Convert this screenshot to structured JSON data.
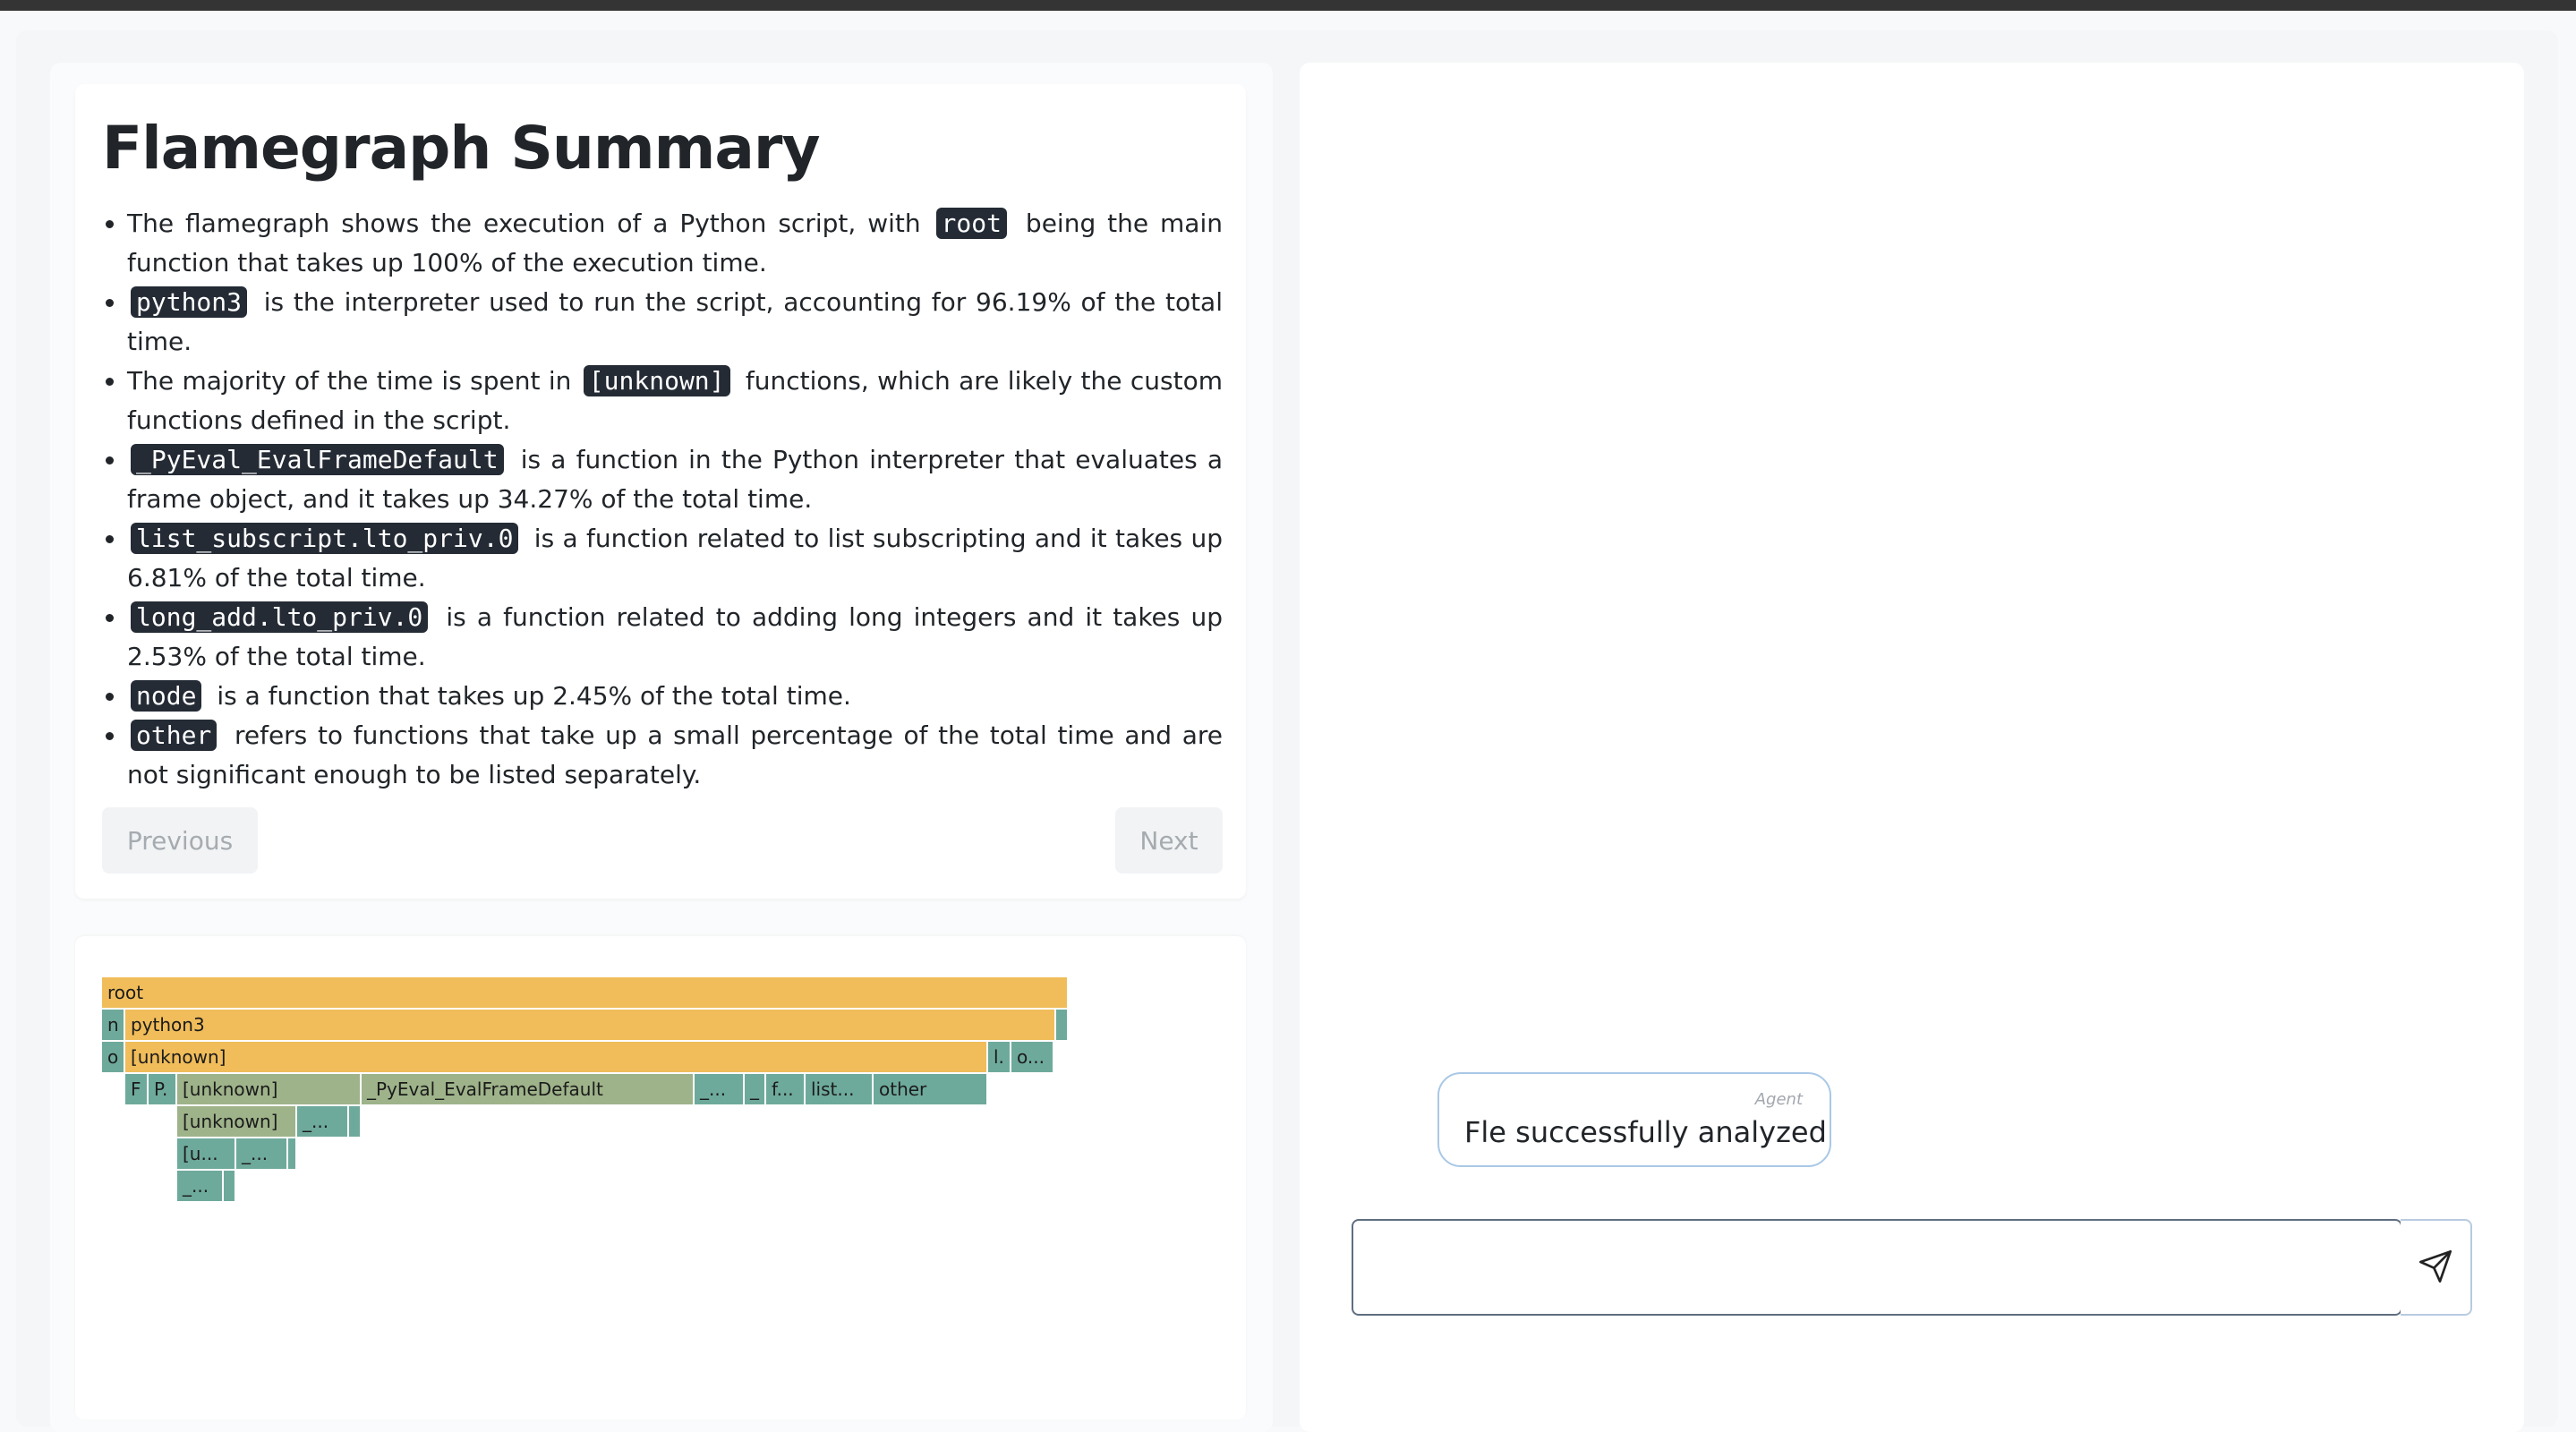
{
  "summary": {
    "title": "Flamegraph Summary",
    "bullets": [
      {
        "pre": "The flamegraph shows the execution of a Python script, with ",
        "code": "root",
        "post": " being the main function that takes up 100% of the execution time."
      },
      {
        "pre": "",
        "code": "python3",
        "post": " is the interpreter used to run the script, accounting for 96.19% of the total time."
      },
      {
        "pre": "The majority of the time is spent in ",
        "code": "[unknown]",
        "post": " functions, which are likely the custom functions defined in the script."
      },
      {
        "pre": "",
        "code": "_PyEval_EvalFrameDefault",
        "post": " is a function in the Python interpreter that evaluates a frame object, and it takes up 34.27% of the total time."
      },
      {
        "pre": "",
        "code": "list_subscript.lto_priv.0",
        "post": " is a function related to list subscripting and it takes up 6.81% of the total time."
      },
      {
        "pre": "",
        "code": "long_add.lto_priv.0",
        "post": " is a function related to adding long integers and it takes up 2.53% of the total time."
      },
      {
        "pre": "",
        "code": "node",
        "post": " is a function that takes up 2.45% of the total time."
      },
      {
        "pre": "",
        "code": "other",
        "post": " refers to functions that take up a small percentage of the total time and are not significant enough to be listed separately."
      }
    ],
    "previous_label": "Previous",
    "next_label": "Next"
  },
  "flamegraph": {
    "frames": [
      {
        "label": "root",
        "color": "gold"
      },
      {
        "label": "n",
        "color": "teal"
      },
      {
        "label": "python3",
        "color": "gold"
      },
      {
        "label": "",
        "color": "teal"
      },
      {
        "label": "o",
        "color": "teal"
      },
      {
        "label": "[unknown]",
        "color": "gold"
      },
      {
        "label": "l.",
        "color": "teal"
      },
      {
        "label": "o...",
        "color": "teal"
      },
      {
        "label": "F",
        "color": "teal"
      },
      {
        "label": "P.",
        "color": "teal"
      },
      {
        "label": "[unknown]",
        "color": "sage"
      },
      {
        "label": "_PyEval_EvalFrameDefault",
        "color": "sage"
      },
      {
        "label": "_...",
        "color": "teal"
      },
      {
        "label": "_",
        "color": "teal"
      },
      {
        "label": "f...",
        "color": "teal"
      },
      {
        "label": "list...",
        "color": "teal"
      },
      {
        "label": "other",
        "color": "teal"
      },
      {
        "label": "[unknown]",
        "color": "sage"
      },
      {
        "label": "_...",
        "color": "teal"
      },
      {
        "label": "",
        "color": "teal"
      },
      {
        "label": "[u...",
        "color": "teal"
      },
      {
        "label": "_...",
        "color": "teal"
      },
      {
        "label": "",
        "color": "teal"
      },
      {
        "label": "_...",
        "color": "teal"
      },
      {
        "label": "",
        "color": "teal"
      }
    ]
  },
  "chat": {
    "messages": [
      {
        "role": "Agent",
        "text": "Fle successfully analyzed"
      }
    ],
    "input_value": "",
    "input_placeholder": "",
    "send_icon": "paper-plane-icon"
  },
  "colors": {
    "gold": "#f0bd5a",
    "teal": "#6eaa9c",
    "sage": "#9eb38a",
    "code_bg": "#242b35",
    "bubble_border": "#a9c8e6"
  }
}
